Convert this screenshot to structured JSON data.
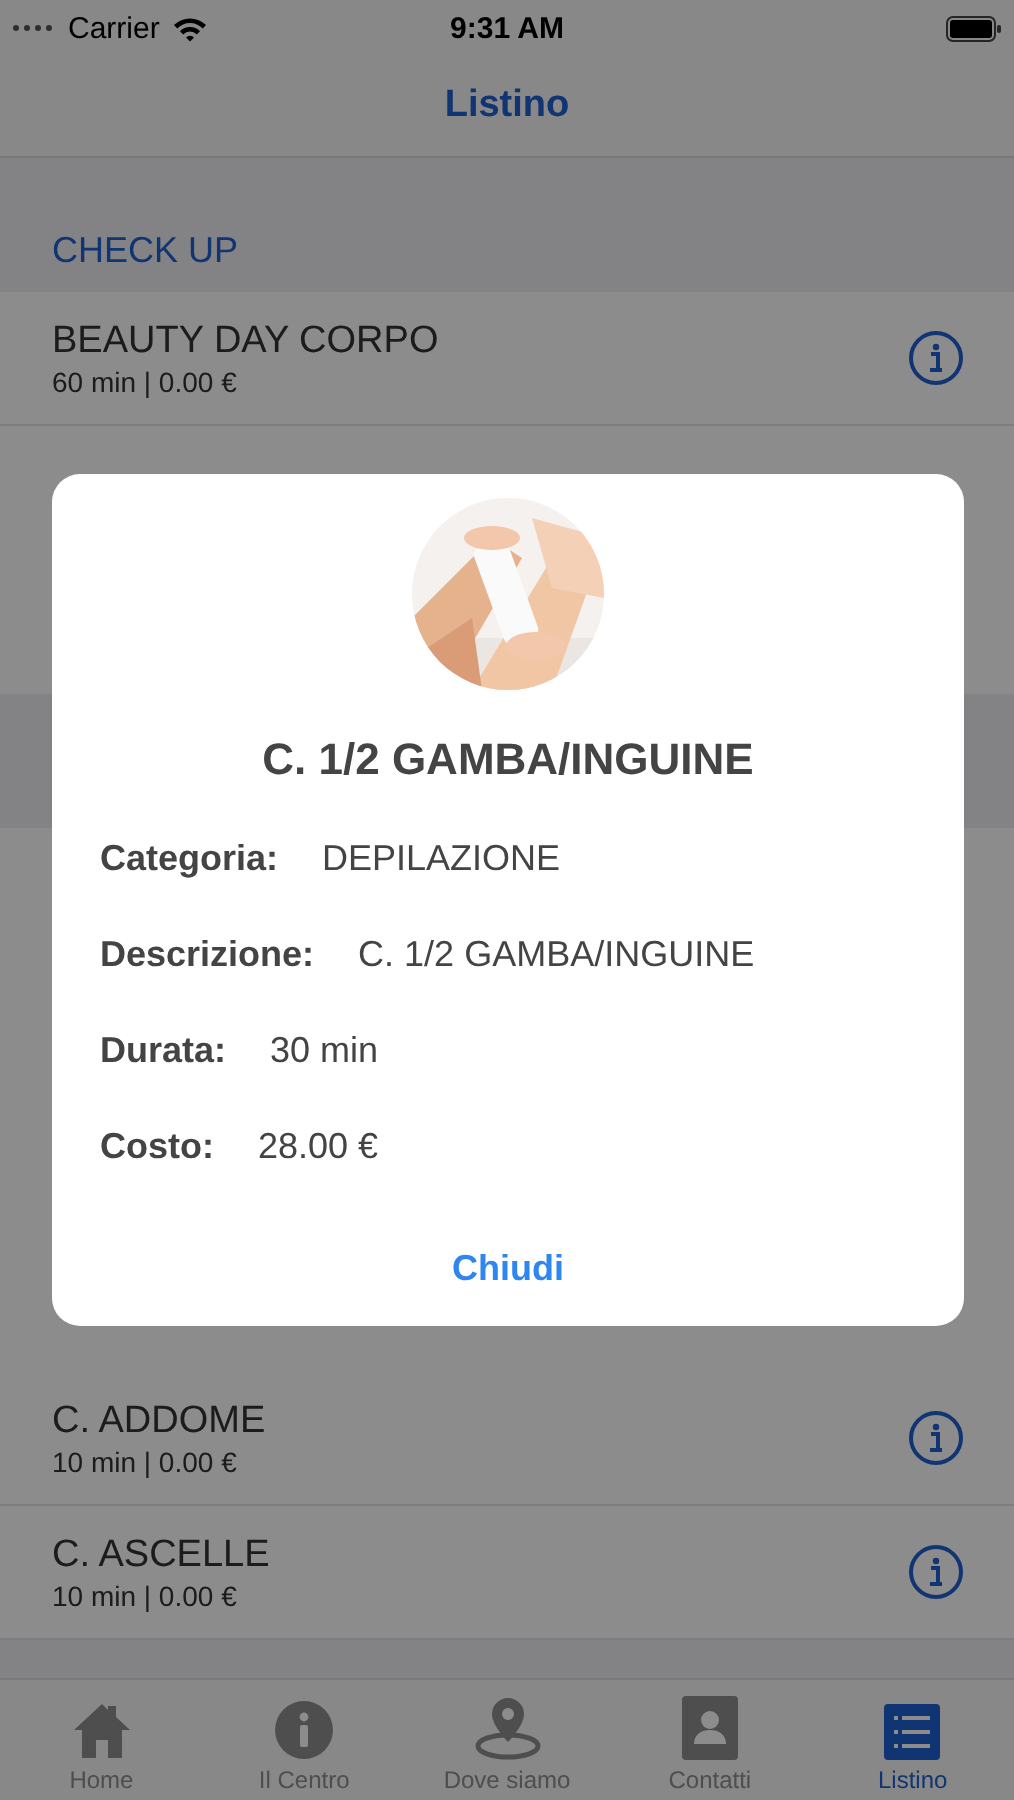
{
  "status_bar": {
    "carrier": "Carrier",
    "time": "9:31 AM"
  },
  "nav": {
    "title": "Listino"
  },
  "sections": [
    {
      "title": "CHECK UP",
      "items": [
        {
          "name": "BEAUTY DAY CORPO",
          "detail": "60 min | 0.00 €"
        }
      ]
    },
    {
      "items": [
        {
          "name": "C. ADDOME",
          "detail": "10 min | 0.00 €"
        },
        {
          "name": "C. ASCELLE",
          "detail": "10 min | 0.00 €"
        }
      ]
    }
  ],
  "dialog": {
    "title": "C. 1/2 GAMBA/INGUINE",
    "fields": [
      {
        "label": "Categoria:",
        "value": "DEPILAZIONE"
      },
      {
        "label": "Descrizione:",
        "value": "C. 1/2 GAMBA/INGUINE"
      },
      {
        "label": "Durata:",
        "value": "30 min"
      },
      {
        "label": "Costo:",
        "value": "28.00 €"
      }
    ],
    "close": "Chiudi"
  },
  "tabs": [
    {
      "kind": "home",
      "label": "Home",
      "selected": false
    },
    {
      "kind": "info",
      "label": "Il Centro",
      "selected": false
    },
    {
      "kind": "pin",
      "label": "Dove siamo",
      "selected": false
    },
    {
      "kind": "contact",
      "label": "Contatti",
      "selected": false
    },
    {
      "kind": "list",
      "label": "Listino",
      "selected": true
    }
  ]
}
